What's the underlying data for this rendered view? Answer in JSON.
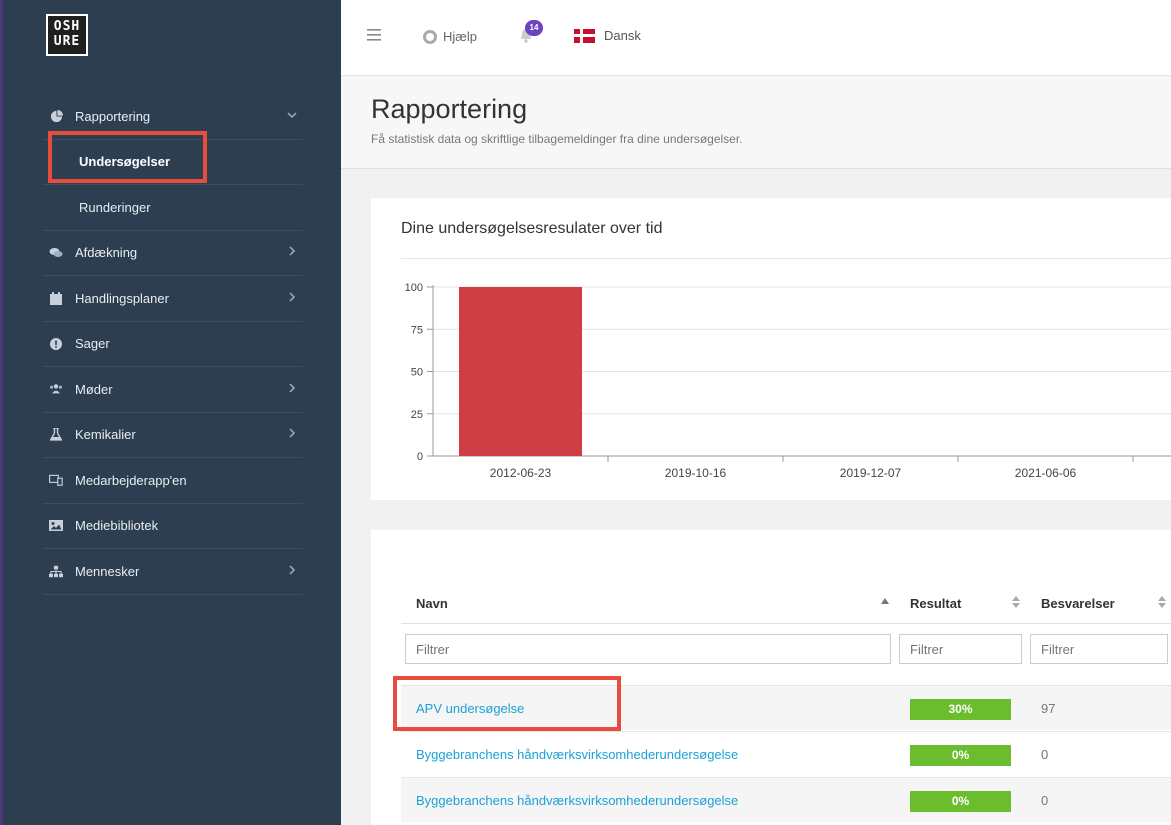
{
  "app": {
    "logo_lines": [
      "OSH",
      "URE"
    ]
  },
  "sidebar": {
    "items": [
      {
        "label": "Rapportering",
        "icon": "pie-chart-icon",
        "expanded": true
      },
      {
        "label": "Undersøgelser",
        "sub": true,
        "active": true
      },
      {
        "label": "Runderinger",
        "sub": true
      },
      {
        "label": "Afdækning",
        "icon": "chat-icon",
        "has_children": true
      },
      {
        "label": "Handlingsplaner",
        "icon": "calendar-icon",
        "has_children": true
      },
      {
        "label": "Sager",
        "icon": "alert-icon"
      },
      {
        "label": "Møder",
        "icon": "users-icon",
        "has_children": true
      },
      {
        "label": "Kemikalier",
        "icon": "flask-icon",
        "has_children": true
      },
      {
        "label": "Medarbejderapp'en",
        "icon": "devices-icon"
      },
      {
        "label": "Mediebibliotek",
        "icon": "image-icon"
      },
      {
        "label": "Mennesker",
        "icon": "org-chart-icon",
        "has_children": true
      }
    ]
  },
  "topbar": {
    "help_label": "Hjælp",
    "notification_count": "14",
    "language_label": "Dansk"
  },
  "page": {
    "title": "Rapportering",
    "subtitle": "Få statistisk data og skriftlige tilbagemeldinger fra dine undersøgelser."
  },
  "chart_data": {
    "type": "bar",
    "title": "Dine undersøgelsesresulater over tid",
    "categories": [
      "2012-06-23",
      "2019-10-16",
      "2019-12-07",
      "2021-06-06"
    ],
    "values": [
      100,
      0,
      0,
      0
    ],
    "ylim": [
      0,
      100
    ],
    "yticks": [
      0,
      25,
      50,
      75,
      100
    ],
    "grid": true,
    "bar_color": "#cf3e45"
  },
  "table": {
    "columns": [
      "Navn",
      "Resultat",
      "Besvarelser"
    ],
    "filter_placeholder": "Filtrer",
    "rows": [
      {
        "name": "APV undersøgelse",
        "result": "30%",
        "responses": "97"
      },
      {
        "name": "Byggebranchens håndværksvirksomhederundersøgelse",
        "result": "0%",
        "responses": "0"
      },
      {
        "name": "Byggebranchens håndværksvirksomhederundersøgelse",
        "result": "0%",
        "responses": "0"
      }
    ]
  },
  "colors": {
    "sidebar_bg": "#2c3e50",
    "highlight": "#e74c3c",
    "link": "#1ba1d6",
    "progress": "#6bbd2e",
    "badge": "#6f42c1"
  }
}
